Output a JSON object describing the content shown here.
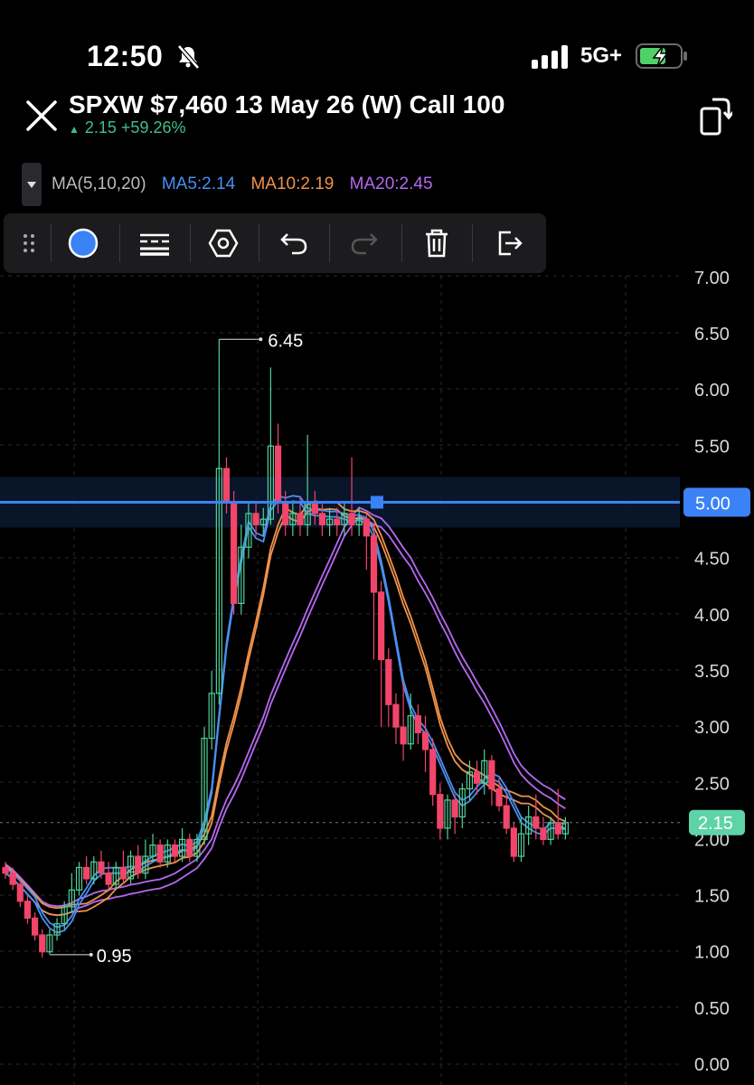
{
  "status_bar": {
    "time": "12:50",
    "network": "5G+",
    "icons": [
      "bell-slash-icon",
      "signal-bars-icon",
      "battery-charging-icon"
    ]
  },
  "header": {
    "title": "SPXW $7,460 13 May 26 (W) Call 100",
    "change_arrow": "▲",
    "change": "2.15 +59.26%",
    "icons": [
      "close-icon",
      "rotate-screen-icon"
    ]
  },
  "indicators": {
    "label": "MA(5,10,20)",
    "ma5": "MA5:2.14",
    "ma10": "MA10:2.19",
    "ma20": "MA20:2.45"
  },
  "toolbar": {
    "icons": [
      "drag-handle-icon",
      "color-dot-icon",
      "line-style-icon",
      "settings-hexagon-icon",
      "undo-icon",
      "redo-icon",
      "trash-icon",
      "exit-icon"
    ]
  },
  "colors": {
    "up": "#4fd19b",
    "down": "#f2456a",
    "ma5": "#4a8ff0",
    "ma10": "#f0924a",
    "ma20": "#b468f0",
    "hline": "#3b82f6",
    "accent_price": "#5fd3a8"
  },
  "chart_data": {
    "type": "candlestick",
    "y_axis_labels": [
      "7.00",
      "6.50",
      "6.00",
      "5.50",
      "5.00",
      "4.50",
      "4.00",
      "3.50",
      "3.00",
      "2.50",
      "2.00",
      "1.50",
      "1.00",
      "0.50",
      "0.00"
    ],
    "ylim": [
      0,
      7
    ],
    "high_marker": "6.45",
    "low_marker": "0.95",
    "horizontal_line": {
      "value": 5.0,
      "label": "5.00"
    },
    "last_price": {
      "value": 2.15,
      "label": "2.15"
    },
    "candles": [
      [
        1.75,
        1.7,
        1.8,
        1.65
      ],
      [
        1.7,
        1.6,
        1.75,
        1.55
      ],
      [
        1.6,
        1.45,
        1.65,
        1.4
      ],
      [
        1.45,
        1.3,
        1.5,
        1.25
      ],
      [
        1.3,
        1.15,
        1.35,
        1.1
      ],
      [
        1.15,
        1.0,
        1.2,
        0.95
      ],
      [
        1.0,
        1.15,
        1.2,
        0.98
      ],
      [
        1.15,
        1.25,
        1.3,
        1.1
      ],
      [
        1.25,
        1.4,
        1.45,
        1.2
      ],
      [
        1.4,
        1.55,
        1.7,
        1.35
      ],
      [
        1.55,
        1.75,
        1.8,
        1.5
      ],
      [
        1.75,
        1.65,
        1.85,
        1.6
      ],
      [
        1.65,
        1.8,
        1.85,
        1.6
      ],
      [
        1.8,
        1.7,
        1.9,
        1.65
      ],
      [
        1.7,
        1.6,
        1.8,
        1.55
      ],
      [
        1.6,
        1.75,
        1.8,
        1.55
      ],
      [
        1.75,
        1.65,
        1.9,
        1.6
      ],
      [
        1.65,
        1.85,
        1.9,
        1.6
      ],
      [
        1.85,
        1.7,
        1.95,
        1.65
      ],
      [
        1.7,
        1.85,
        2.0,
        1.65
      ],
      [
        1.85,
        1.95,
        2.05,
        1.8
      ],
      [
        1.95,
        1.8,
        2.0,
        1.75
      ],
      [
        1.8,
        1.95,
        2.0,
        1.75
      ],
      [
        1.95,
        1.85,
        2.0,
        1.8
      ],
      [
        1.85,
        2.0,
        2.1,
        1.8
      ],
      [
        2.0,
        1.85,
        2.05,
        1.8
      ],
      [
        1.85,
        2.0,
        2.05,
        1.8
      ],
      [
        2.0,
        2.9,
        3.0,
        1.95
      ],
      [
        2.9,
        3.3,
        3.5,
        2.8
      ],
      [
        3.3,
        5.3,
        6.45,
        3.2
      ],
      [
        5.3,
        5.0,
        5.4,
        4.9
      ],
      [
        5.0,
        4.1,
        5.1,
        4.0
      ],
      [
        4.1,
        4.6,
        4.8,
        4.0
      ],
      [
        4.6,
        4.9,
        5.0,
        4.5
      ],
      [
        4.9,
        4.8,
        5.0,
        4.7
      ],
      [
        4.8,
        4.85,
        4.95,
        4.7
      ],
      [
        4.85,
        5.5,
        6.2,
        4.8
      ],
      [
        5.5,
        5.0,
        5.7,
        4.9
      ],
      [
        5.0,
        4.8,
        5.1,
        4.7
      ],
      [
        4.8,
        4.9,
        5.0,
        4.7
      ],
      [
        4.9,
        4.8,
        5.05,
        4.7
      ],
      [
        4.8,
        5.0,
        5.6,
        4.7
      ],
      [
        5.0,
        4.9,
        5.1,
        4.8
      ],
      [
        4.9,
        4.8,
        5.0,
        4.7
      ],
      [
        4.8,
        4.85,
        4.95,
        4.7
      ],
      [
        4.85,
        4.8,
        4.95,
        4.7
      ],
      [
        4.8,
        4.9,
        5.0,
        4.7
      ],
      [
        4.9,
        4.8,
        5.4,
        4.7
      ],
      [
        4.8,
        4.85,
        4.95,
        4.7
      ],
      [
        4.85,
        4.7,
        4.9,
        4.4
      ],
      [
        4.7,
        4.2,
        4.8,
        3.6
      ],
      [
        4.2,
        3.6,
        4.3,
        3.0
      ],
      [
        3.6,
        3.2,
        3.7,
        3.0
      ],
      [
        3.2,
        3.0,
        3.3,
        2.85
      ],
      [
        3.0,
        2.85,
        3.4,
        2.7
      ],
      [
        2.85,
        3.1,
        3.3,
        2.8
      ],
      [
        3.1,
        2.95,
        3.2,
        2.85
      ],
      [
        2.95,
        2.8,
        3.1,
        2.6
      ],
      [
        2.8,
        2.4,
        2.9,
        2.3
      ],
      [
        2.4,
        2.1,
        2.5,
        2.0
      ],
      [
        2.1,
        2.35,
        2.4,
        2.0
      ],
      [
        2.35,
        2.2,
        2.4,
        2.05
      ],
      [
        2.2,
        2.45,
        2.5,
        2.1
      ],
      [
        2.45,
        2.6,
        2.7,
        2.35
      ],
      [
        2.6,
        2.5,
        2.7,
        2.4
      ],
      [
        2.5,
        2.7,
        2.8,
        2.4
      ],
      [
        2.7,
        2.45,
        2.75,
        2.3
      ],
      [
        2.45,
        2.3,
        2.55,
        2.25
      ],
      [
        2.3,
        2.1,
        2.4,
        2.05
      ],
      [
        2.1,
        1.85,
        2.15,
        1.8
      ],
      [
        1.85,
        2.05,
        2.2,
        1.8
      ],
      [
        2.05,
        2.2,
        2.3,
        1.95
      ],
      [
        2.2,
        2.1,
        2.4,
        2.0
      ],
      [
        2.1,
        2.0,
        2.2,
        1.95
      ],
      [
        2.0,
        2.15,
        2.2,
        1.95
      ],
      [
        2.15,
        2.05,
        2.45,
        2.0
      ],
      [
        2.05,
        2.15,
        2.2,
        2.0
      ]
    ]
  }
}
